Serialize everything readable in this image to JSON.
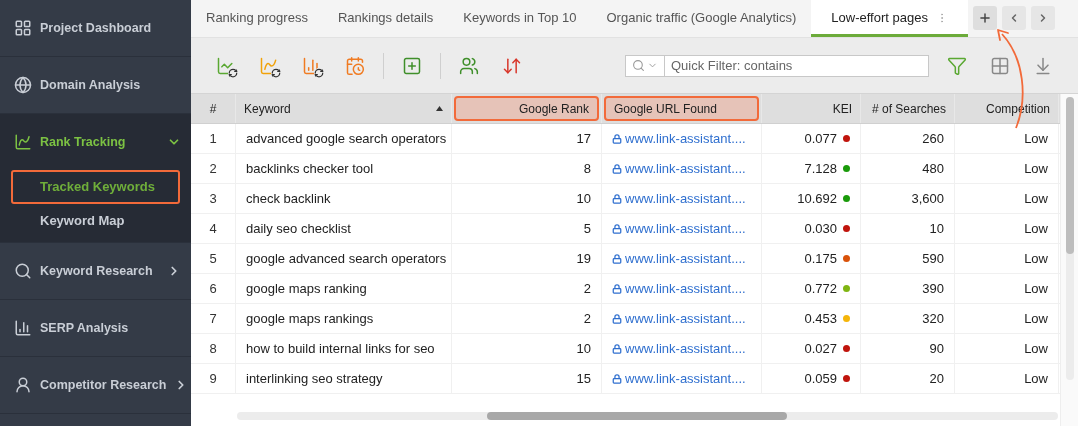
{
  "sidebar": {
    "items": [
      {
        "label": "Project Dashboard",
        "kind": "link",
        "selected": false
      },
      {
        "label": "Domain Analysis",
        "kind": "link",
        "selected": false
      },
      {
        "label": "Rank Tracking",
        "kind": "group",
        "selected": true,
        "expanded": true,
        "children": [
          {
            "label": "Tracked Keywords",
            "selected": true,
            "highlighted": true
          },
          {
            "label": "Keyword Map",
            "selected": false,
            "highlighted": false
          }
        ]
      },
      {
        "label": "Keyword Research",
        "kind": "group",
        "selected": false,
        "expanded": false
      },
      {
        "label": "SERP Analysis",
        "kind": "link",
        "selected": false
      },
      {
        "label": "Competitor Research",
        "kind": "group",
        "selected": false,
        "expanded": false
      }
    ]
  },
  "tabs": [
    {
      "label": "Ranking progress",
      "selected": false
    },
    {
      "label": "Rankings details",
      "selected": false
    },
    {
      "label": "Keywords in Top 10",
      "selected": false
    },
    {
      "label": "Organic traffic (Google Analytics)",
      "selected": false
    },
    {
      "label": "Low-effort pages",
      "selected": true
    }
  ],
  "search": {
    "placeholder": "Quick Filter: contains"
  },
  "table": {
    "columns": [
      {
        "label": "#",
        "highlighted": false,
        "sorted": false
      },
      {
        "label": "Keyword",
        "highlighted": false,
        "sorted": true
      },
      {
        "label": "Google Rank",
        "highlighted": true,
        "sorted": false
      },
      {
        "label": "Google URL Found",
        "highlighted": true,
        "sorted": false
      },
      {
        "label": "KEI",
        "highlighted": false,
        "sorted": false
      },
      {
        "label": "# of Searches",
        "highlighted": false,
        "sorted": false
      },
      {
        "label": "Competition",
        "highlighted": false,
        "sorted": false
      }
    ],
    "rows": [
      {
        "num": "1",
        "keyword": "advanced google search operators",
        "rank": "17",
        "url": "www.link-assistant....",
        "kei": "0.077",
        "color": "#c0140c",
        "searches": "260",
        "competition": "Low"
      },
      {
        "num": "2",
        "keyword": "backlinks checker tool",
        "rank": "8",
        "url": "www.link-assistant....",
        "kei": "7.128",
        "color": "#1a9a0a",
        "searches": "480",
        "competition": "Low"
      },
      {
        "num": "3",
        "keyword": "check backlink",
        "rank": "10",
        "url": "www.link-assistant....",
        "kei": "10.692",
        "color": "#1a9a0a",
        "searches": "3,600",
        "competition": "Low"
      },
      {
        "num": "4",
        "keyword": "daily seo checklist",
        "rank": "5",
        "url": "www.link-assistant....",
        "kei": "0.030",
        "color": "#c0140c",
        "searches": "10",
        "competition": "Low"
      },
      {
        "num": "5",
        "keyword": "google advanced search operators",
        "rank": "19",
        "url": "www.link-assistant....",
        "kei": "0.175",
        "color": "#d9520a",
        "searches": "590",
        "competition": "Low"
      },
      {
        "num": "6",
        "keyword": "google maps ranking",
        "rank": "2",
        "url": "www.link-assistant....",
        "kei": "0.772",
        "color": "#7fb512",
        "searches": "390",
        "competition": "Low"
      },
      {
        "num": "7",
        "keyword": "google maps rankings",
        "rank": "2",
        "url": "www.link-assistant....",
        "kei": "0.453",
        "color": "#f5b50a",
        "searches": "320",
        "competition": "Low"
      },
      {
        "num": "8",
        "keyword": "how to build internal links for seo",
        "rank": "10",
        "url": "www.link-assistant....",
        "kei": "0.027",
        "color": "#c0140c",
        "searches": "90",
        "competition": "Low"
      },
      {
        "num": "9",
        "keyword": "interlinking seo strategy",
        "rank": "15",
        "url": "www.link-assistant....",
        "kei": "0.059",
        "color": "#c0140c",
        "searches": "20",
        "competition": "Low"
      }
    ]
  }
}
